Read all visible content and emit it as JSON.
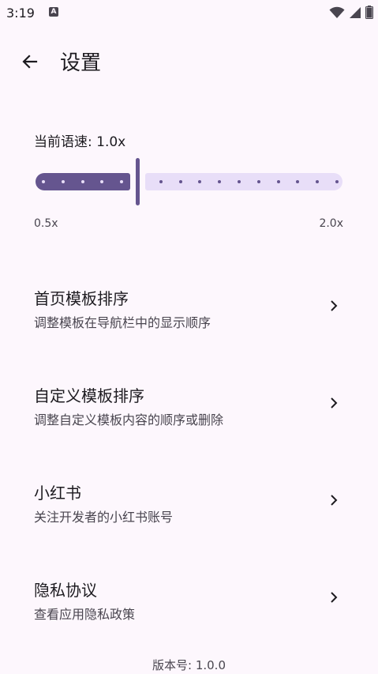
{
  "status_bar": {
    "time": "3:19",
    "app_icon_glyph": "A",
    "icons": [
      "wifi-icon",
      "cellular-signal-icon",
      "battery-icon"
    ]
  },
  "top_bar": {
    "back_icon": "arrow-left-icon",
    "title": "设置"
  },
  "speed": {
    "label": "当前语速: 1.0x",
    "min_label": "0.5x",
    "max_label": "2.0x",
    "min": 0.5,
    "max": 2.0,
    "step": 0.1,
    "value": 1.0
  },
  "settings": [
    {
      "title": "首页模板排序",
      "subtitle": "调整模板在导航栏中的显示顺序",
      "icon": "chevron-right-icon"
    },
    {
      "title": "自定义模板排序",
      "subtitle": "调整自定义模板内容的顺序或删除",
      "icon": "chevron-right-icon"
    },
    {
      "title": "小红书",
      "subtitle": "关注开发者的小红书账号",
      "icon": "chevron-right-icon"
    },
    {
      "title": "隐私协议",
      "subtitle": "查看应用隐私政策",
      "icon": "chevron-right-icon"
    }
  ],
  "footer": {
    "version": "版本号: 1.0.0"
  },
  "colors": {
    "background": "#fdf7fd",
    "accent": "#65558f",
    "accent_container": "#e8def8",
    "text_primary": "#1d1b20",
    "text_secondary": "#49454f"
  }
}
